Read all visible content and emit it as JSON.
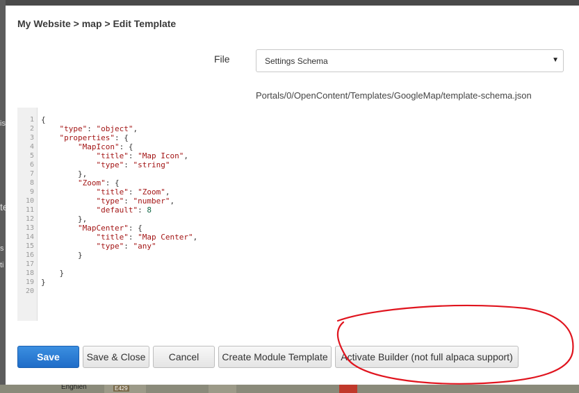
{
  "background": {
    "left_edge_fragments": [
      "is",
      "te",
      "s",
      "ti"
    ],
    "map_town": "Enghien",
    "map_route": "E429"
  },
  "dialog": {
    "breadcrumb": "My Website > map > Edit Template",
    "file_label": "File",
    "file_select_value": "Settings Schema",
    "file_path": "Portals/0/OpenContent/Templates/GoogleMap/template-schema.json"
  },
  "editor": {
    "line_numbers": [
      "1",
      "2",
      "3",
      "4",
      "5",
      "6",
      "7",
      "8",
      "9",
      "10",
      "11",
      "12",
      "13",
      "14",
      "15",
      "16",
      "17",
      "18",
      "19",
      "20"
    ],
    "lines": [
      "{",
      "    \"type\": \"object\",",
      "    \"properties\": {",
      "        \"MapIcon\": {",
      "            \"title\": \"Map Icon\",",
      "            \"type\": \"string\"",
      "        },",
      "        \"Zoom\": {",
      "            \"title\": \"Zoom\",",
      "            \"type\": \"number\",",
      "            \"default\": 8",
      "        },",
      "        \"MapCenter\": {",
      "            \"title\": \"Map Center\",",
      "            \"type\": \"any\"",
      "        }",
      "",
      "    }",
      "}",
      ""
    ]
  },
  "buttons": {
    "save": "Save",
    "save_close": "Save & Close",
    "cancel": "Cancel",
    "create_module_template": "Create Module Template",
    "activate_builder": "Activate Builder (not full alpaca support)"
  },
  "colors": {
    "primary_button": "#1f6cc8",
    "annotation_circle": "#e0141e",
    "json_string": "#a31515",
    "json_number": "#116644"
  }
}
